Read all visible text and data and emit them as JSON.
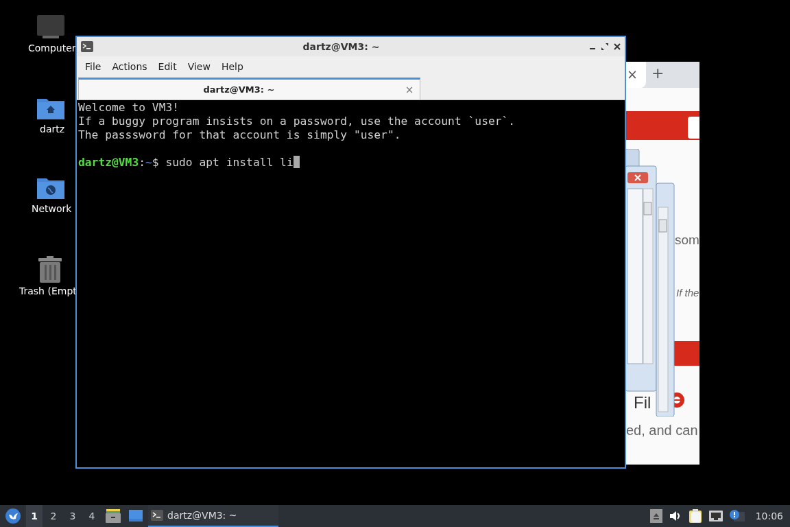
{
  "desktop_icons": [
    {
      "label": "Computer",
      "kind": "computer"
    },
    {
      "label": "dartz",
      "kind": "home"
    },
    {
      "label": "Network",
      "kind": "network"
    },
    {
      "label": "Trash (Empt",
      "kind": "trash"
    }
  ],
  "background_window": {
    "tab_close": "×",
    "new_tab": "+",
    "text_1": "som",
    "text_2": "If the",
    "heading": "Fil",
    "text_3": "ed, and can"
  },
  "terminal": {
    "title": "dartz@VM3: ~",
    "menu": [
      "File",
      "Actions",
      "Edit",
      "View",
      "Help"
    ],
    "tabs": [
      {
        "label": "dartz@VM3: ~",
        "selected": true,
        "close": "×"
      }
    ],
    "lines": [
      "Welcome to VM3!",
      "If a buggy program insists on a password, use the account `user`.",
      "The passsword for that account is simply \"user\"."
    ],
    "prompt": {
      "user_host": "dartz@VM3",
      "separator": ":",
      "path": "~",
      "symbol": "$",
      "command": "sudo apt install li"
    }
  },
  "taskbar": {
    "workspaces": [
      {
        "label": "1",
        "selected": true
      },
      {
        "label": "2",
        "selected": false
      },
      {
        "label": "3",
        "selected": false
      },
      {
        "label": "4",
        "selected": false
      }
    ],
    "tasks": [
      {
        "label": "dartz@VM3: ~",
        "selected": true
      }
    ],
    "clock": "10:06"
  }
}
